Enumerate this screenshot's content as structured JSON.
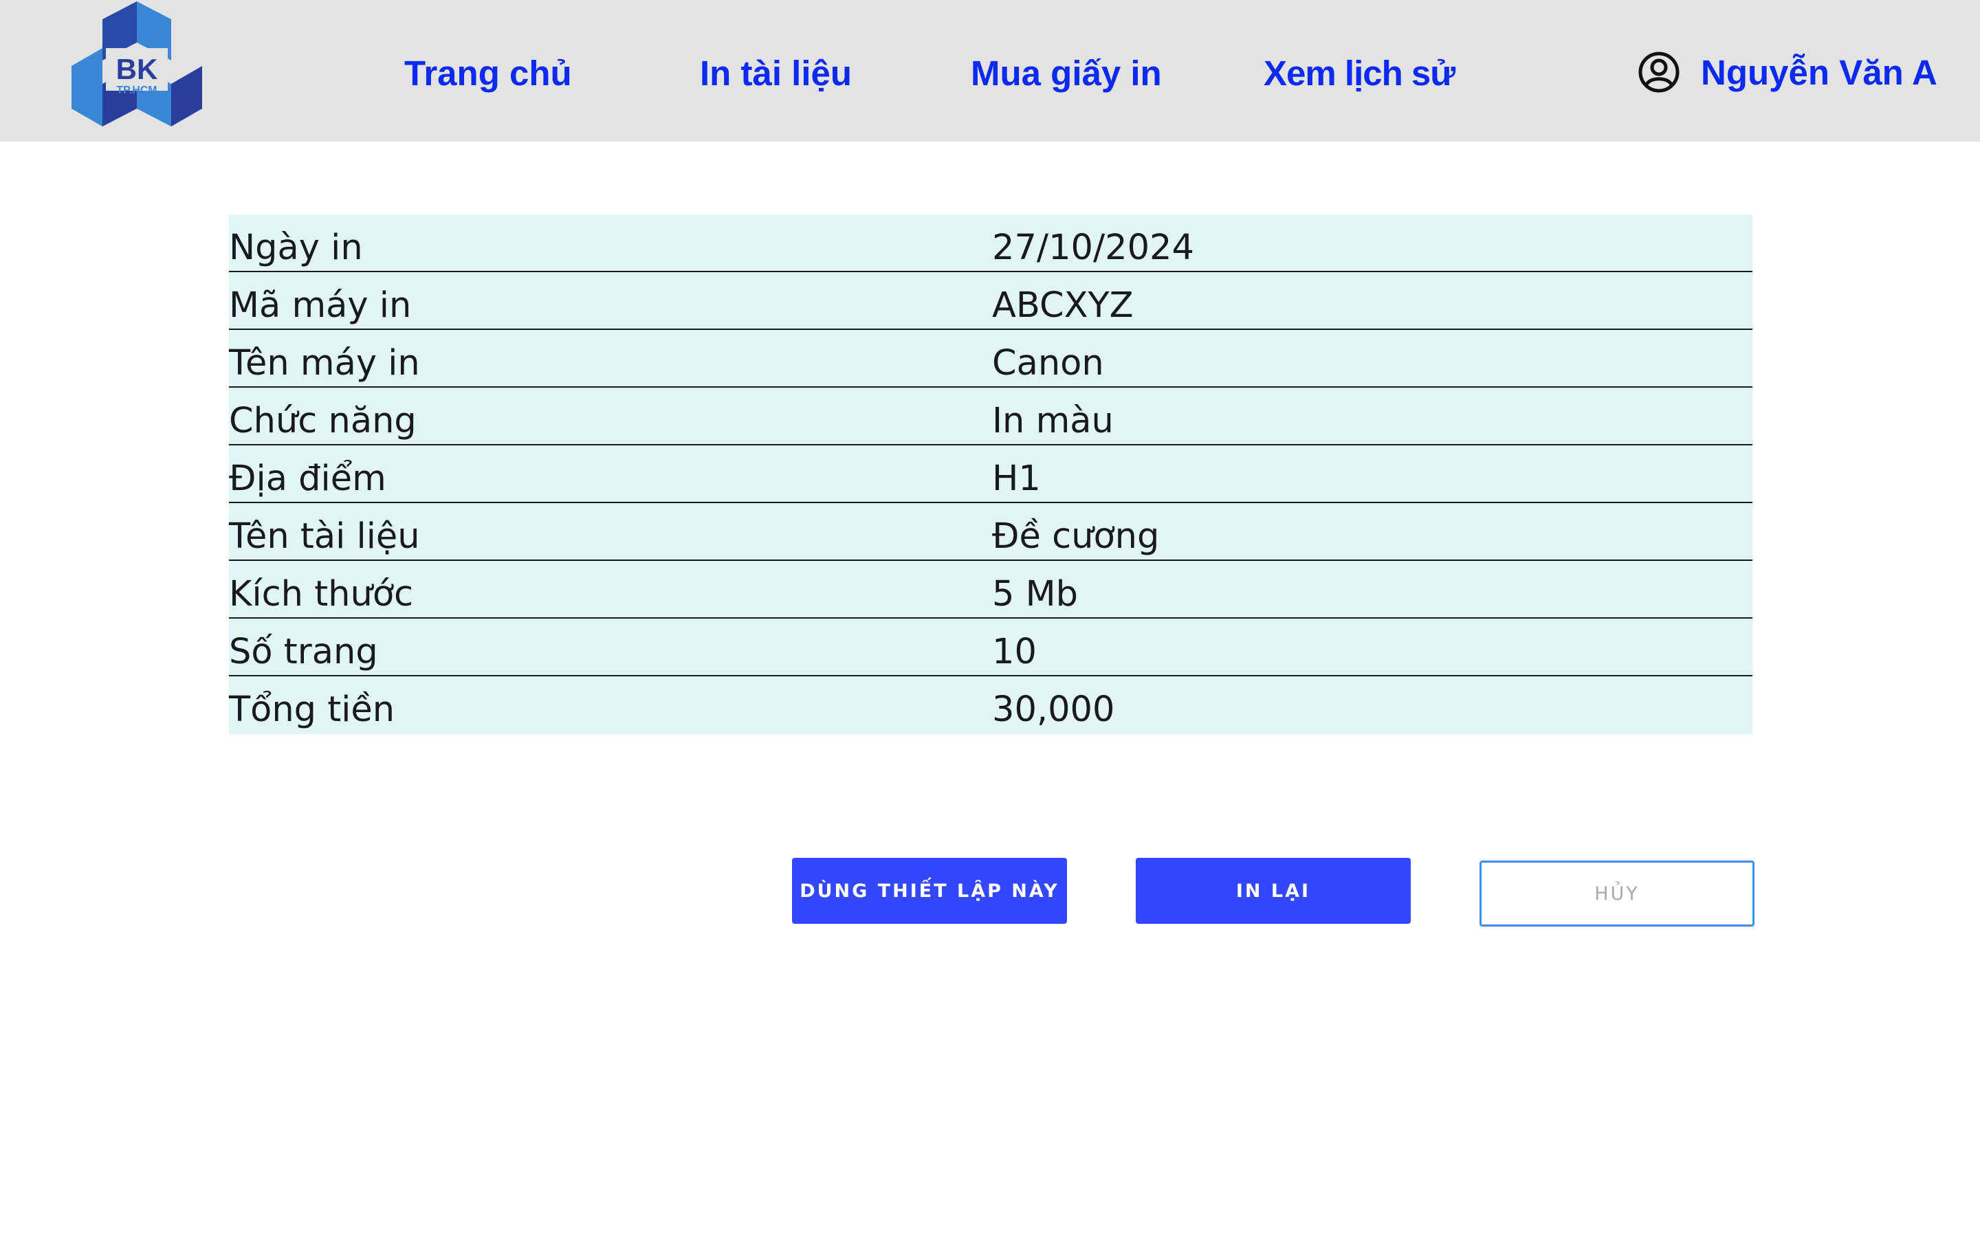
{
  "logo": {
    "text": "BK",
    "subtext": "TP.HCM"
  },
  "nav": {
    "home": "Trang chủ",
    "print": "In tài liệu",
    "buy_paper": "Mua giấy in",
    "history": "Xem lịch sử"
  },
  "user": {
    "name": "Nguyễn Văn A",
    "icon": "user-circle-icon"
  },
  "details": [
    {
      "label": "Ngày in",
      "value": "27/10/2024"
    },
    {
      "label": "Mã máy in",
      "value": "ABCXYZ"
    },
    {
      "label": "Tên máy in",
      "value": "Canon"
    },
    {
      "label": "Chức năng",
      "value": "In màu"
    },
    {
      "label": "Địa điểm",
      "value": "H1"
    },
    {
      "label": "Tên tài liệu",
      "value": "Đề cương"
    },
    {
      "label": "Kích thước",
      "value": "5 Mb"
    },
    {
      "label": "Số trang",
      "value": "10"
    },
    {
      "label": "Tổng tiền",
      "value": "30,000"
    }
  ],
  "buttons": {
    "use_settings": "DÙNG THIẾT LẬP NÀY",
    "reprint": "IN LẠI",
    "cancel": "HỦY"
  },
  "colors": {
    "header_bg": "#e3e3e3",
    "nav_text": "#0d2bf0",
    "table_bg": "#e2f5f5",
    "primary_button": "#3347ff",
    "outline_border": "#3f8ee8"
  }
}
